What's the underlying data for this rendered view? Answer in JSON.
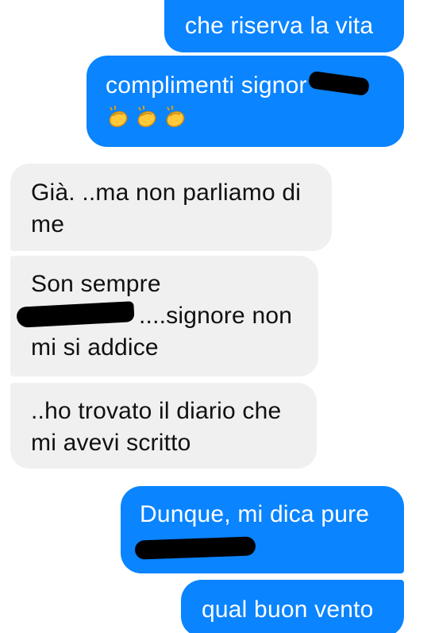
{
  "conversation": {
    "messages": [
      {
        "side": "sent",
        "lines": [
          "che riserva la vita"
        ]
      },
      {
        "side": "sent",
        "lines": [
          "complimenti signor"
        ],
        "emoji": [
          "clapping-hands",
          "clapping-hands",
          "clapping-hands"
        ]
      },
      {
        "side": "received",
        "lines": [
          "Già. ..ma non parliamo di",
          "me"
        ]
      },
      {
        "side": "received",
        "lines": [
          "Son sempre",
          "....signore non",
          "mi si addice"
        ]
      },
      {
        "side": "received",
        "lines": [
          "..ho trovato il diario che",
          "mi avevi scritto"
        ]
      },
      {
        "side": "sent",
        "lines": [
          "Dunque, mi dica pure"
        ]
      },
      {
        "side": "sent",
        "lines": [
          "qual buon vento"
        ]
      }
    ]
  },
  "colors": {
    "sent_bubble": "#0a84ff",
    "received_bubble": "#f1f0f0",
    "sent_text": "#ffffff",
    "received_text": "#111111"
  }
}
